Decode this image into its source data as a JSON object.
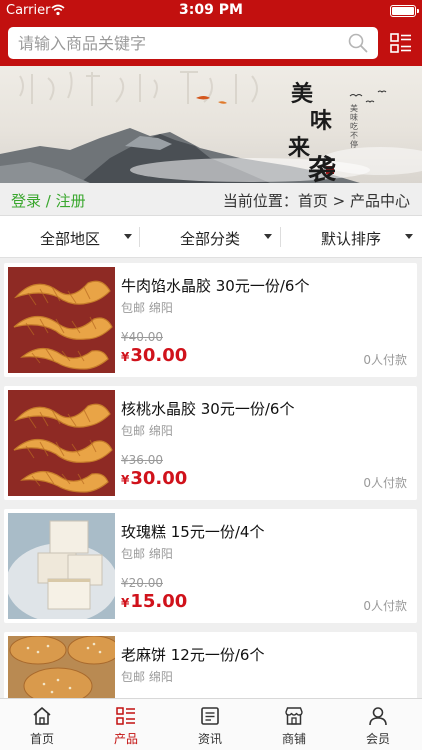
{
  "status_bar": {
    "carrier": "Carrier",
    "time": "3:09 PM"
  },
  "search": {
    "placeholder": "请输入商品关键字"
  },
  "icons": {
    "search": "search-icon",
    "menu": "list-grid-icon",
    "wifi": "wifi-icon",
    "battery": "battery-icon"
  },
  "banner": {
    "title_chars": [
      "美",
      "味",
      "来",
      "袭"
    ],
    "small_text": "美味吃不停"
  },
  "breadcrumb": {
    "login": "登录 / 注册",
    "location": "当前位置：首页 > 产品中心"
  },
  "filters": [
    {
      "label": "全部地区"
    },
    {
      "label": "全部分类"
    },
    {
      "label": "默认排序"
    }
  ],
  "products": [
    {
      "title": "牛肉馅水晶胶 30元一份/6个",
      "meta": "包邮 绵阳",
      "old_price": "¥40.00",
      "currency": "¥",
      "price": "30.00",
      "sold": "0人付款",
      "image": "twisted-pastry"
    },
    {
      "title": "核桃水晶胶 30元一份/6个",
      "meta": "包邮 绵阳",
      "old_price": "¥36.00",
      "currency": "¥",
      "price": "30.00",
      "sold": "0人付款",
      "image": "twisted-pastry"
    },
    {
      "title": "玫瑰糕 15元一份/4个",
      "meta": "包邮 绵阳",
      "old_price": "¥20.00",
      "currency": "¥",
      "price": "15.00",
      "sold": "0人付款",
      "image": "rice-cake"
    },
    {
      "title": "老麻饼 12元一份/6个",
      "meta": "包邮 绵阳",
      "old_price": "",
      "currency": "¥",
      "price": "",
      "sold": "",
      "image": "sesame-cake"
    }
  ],
  "tabbar": [
    {
      "label": "首页",
      "icon": "home-icon",
      "active": false
    },
    {
      "label": "产品",
      "icon": "product-list-icon",
      "active": true
    },
    {
      "label": "资讯",
      "icon": "news-icon",
      "active": false
    },
    {
      "label": "商铺",
      "icon": "shop-icon",
      "active": false
    },
    {
      "label": "会员",
      "icon": "user-icon",
      "active": false
    }
  ],
  "colors": {
    "brand_red": "#c2100f",
    "price_red": "#d0121b",
    "login_green": "#3aa72e"
  }
}
